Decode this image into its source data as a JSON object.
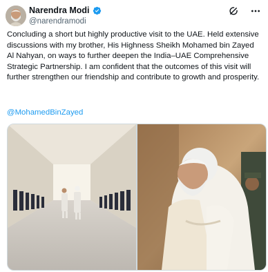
{
  "author": {
    "display_name": "Narendra Modi",
    "handle": "@narendramodi",
    "verified": true,
    "verified_color": "#1d9bf0"
  },
  "actions": {
    "grok_icon": "grok-icon",
    "more_icon": "more-options-icon"
  },
  "tweet": {
    "text": "Concluding a short but highly productive visit to the UAE. Held extensive discussions with my brother, His Highness Sheikh Mohamed bin Zayed Al Nahyan, on ways to further deepen the India–UAE Comprehensive Strategic Partnership. I am confident that the outcomes of this visit will further strengthen our friendship and contribute to growth and prosperity.",
    "mention": "@MohamedBinZayed",
    "link_color": "#1d9bf0"
  },
  "media": {
    "photo_count": 2
  }
}
